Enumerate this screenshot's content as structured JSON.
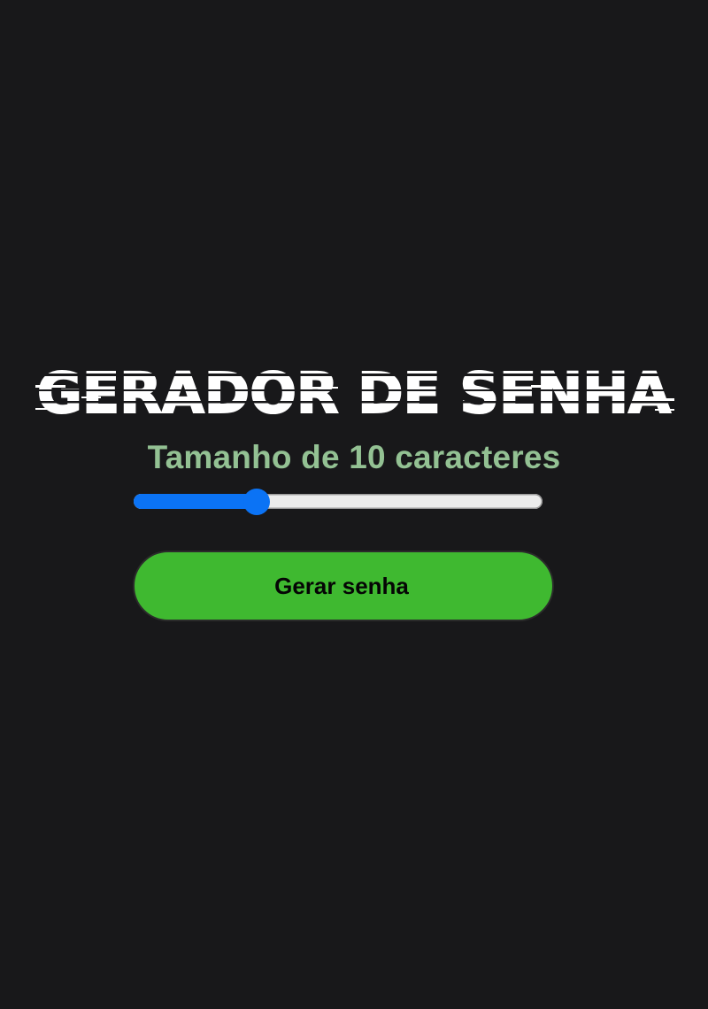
{
  "header": {
    "title": "GERADOR DE SENHA"
  },
  "password_length": {
    "label": "Tamanho de 10 caracteres",
    "value": 10,
    "fill_fraction": 0.3
  },
  "actions": {
    "generate_label": "Gerar senha"
  },
  "colors": {
    "background": "#18181a",
    "title": "#ffffff",
    "label": "#93c193",
    "slider_accent": "#0b73f5",
    "slider_track": "#ececec",
    "button": "#3fb930",
    "button_text": "#050505"
  }
}
